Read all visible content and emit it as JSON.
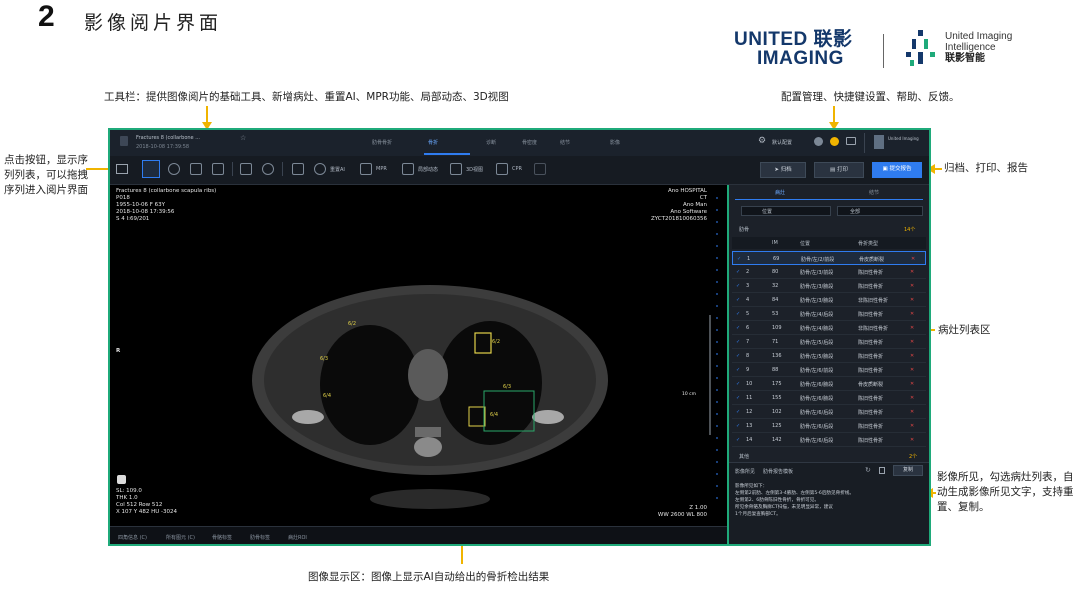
{
  "header": {
    "section_number": "2",
    "section_title": "影像阅片界面",
    "logo_united": "UNITED 联影",
    "logo_imaging": "IMAGING",
    "logo_uii_line1": "United Imaging",
    "logo_uii_line2": "Intelligence",
    "logo_uii_cn": "联影智能"
  },
  "annotations": {
    "toolbar": "工具栏：提供图像阅片的基础工具、新增病灶、重置AI、MPR功能、局部动态、3D视图",
    "config": "配置管理、快捷键设置、帮助、反馈。",
    "series": "点击按钮，显示序列列表，可以拖拽序列进入阅片界面",
    "archive": "归档、打印、报告",
    "lesion_list": "病灶列表区",
    "findings": "影像所见，勾选病灶列表，自动生成影像所见文字，支持重置、复制。",
    "display": "图像显示区：图像上显示AI自动给出的骨折检出结果"
  },
  "app": {
    "patient_title": "Fractures 8 (collarbone ...",
    "patient_sub": "2018-10-08 17:39:58",
    "tabs": [
      "肋骨骨折",
      "骨折",
      "诊断",
      "骨密度",
      "结节",
      "影像"
    ],
    "config_label": "默认配置",
    "toolbar_labels": [
      "重置AI",
      "MPR",
      "局部动态",
      "3D视图",
      "CPR"
    ],
    "btn_archive": "归档",
    "btn_print": "打印",
    "btn_report": "提交报告",
    "overlay_tl": "Fractures 8 (collarbone scapula ribs)\nP018\n1955-10-06 F 63Y\n2018-10-08 17:39:56\nS 4 I:69/201",
    "overlay_tr": "Ano HOSPITAL\nCT\nAno Man\nAno Software\nZYCT201810060356",
    "overlay_bl": "SL: 109.0\nTHK 1.0\nCol 512 Row 512\nX 107 Y 482 HU -3024",
    "overlay_br": "Z 1.00\nWW 2600 WL 800",
    "marker_r": "R",
    "scale_label": "10 cm",
    "bottom_tags": [
      "四角信息 (C)",
      "所有图元 (C)",
      "骨骼标签",
      "肋骨标签",
      "病灶ROI"
    ],
    "panel_tabs": [
      "病灶",
      "结节"
    ],
    "filter_pos": "位置",
    "filter_type": "全部",
    "group_label": "肋骨",
    "group_count": "14个",
    "col_headers": [
      "IM",
      "位置",
      "骨折类型"
    ],
    "lesions": [
      {
        "n": "1",
        "im": "69",
        "pos": "肋骨/左/2/前段",
        "type": "骨皮质断裂"
      },
      {
        "n": "2",
        "im": "80",
        "pos": "肋骨/左/3/前段",
        "type": "陈旧性骨折"
      },
      {
        "n": "3",
        "im": "32",
        "pos": "肋骨/左/3/腋段",
        "type": "陈旧性骨折"
      },
      {
        "n": "4",
        "im": "84",
        "pos": "肋骨/左/3/腋段",
        "type": "非陈旧性骨折"
      },
      {
        "n": "5",
        "im": "53",
        "pos": "肋骨/左/4/后段",
        "type": "陈旧性骨折"
      },
      {
        "n": "6",
        "im": "109",
        "pos": "肋骨/左/4/腋段",
        "type": "非陈旧性骨折"
      },
      {
        "n": "7",
        "im": "71",
        "pos": "肋骨/左/5/后段",
        "type": "陈旧性骨折"
      },
      {
        "n": "8",
        "im": "136",
        "pos": "肋骨/左/5/腋段",
        "type": "陈旧性骨折"
      },
      {
        "n": "9",
        "im": "88",
        "pos": "肋骨/左/6/前段",
        "type": "陈旧性骨折"
      },
      {
        "n": "10",
        "im": "175",
        "pos": "肋骨/左/6/腋段",
        "type": "骨皮质断裂"
      },
      {
        "n": "11",
        "im": "155",
        "pos": "肋骨/左/6/腋段",
        "type": "陈旧性骨折"
      },
      {
        "n": "12",
        "im": "102",
        "pos": "肋骨/左/6/后段",
        "type": "陈旧性骨折"
      },
      {
        "n": "13",
        "im": "125",
        "pos": "肋骨/左/6/后段",
        "type": "陈旧性骨折"
      },
      {
        "n": "14",
        "im": "142",
        "pos": "肋骨/左/6/后段",
        "type": "陈旧性骨折"
      }
    ],
    "other_group": "其他",
    "other_count": "2个",
    "findings_label": "影像所见",
    "findings_select": "肋骨报告模板",
    "copy_btn": "复制",
    "findings_text": "影像所见如下：\n左侧第2前肋、左侧第3-4腋肋、左侧第5-6后肋见骨折线。\n左侧第2、6肋骨陈旧性骨折，骨折可见。\n所见余骨骼及胸廓CT扫描，未见明显异常，建议\n1个月后复查胸部CT。"
  },
  "colors": {
    "accent_green": "#1faa7a",
    "arrow_yellow": "#f0b400",
    "brand_blue": "#14386b",
    "primary_blue": "#2f7cf0"
  }
}
